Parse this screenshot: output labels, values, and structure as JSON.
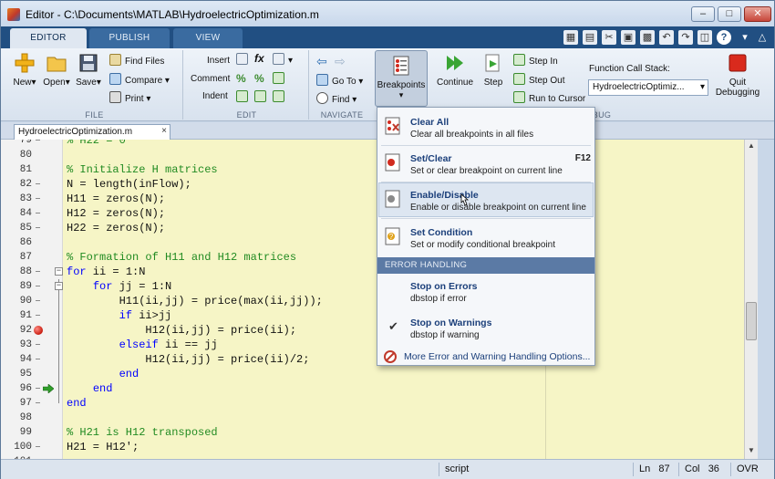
{
  "window": {
    "title": "Editor - C:\\Documents\\MATLAB\\HydroelectricOptimization.m"
  },
  "tabs": [
    "EDITOR",
    "PUBLISH",
    "VIEW"
  ],
  "toolstrip": {
    "file": {
      "label": "FILE",
      "new": "New",
      "open": "Open",
      "save": "Save",
      "find_files": "Find Files",
      "compare": "Compare",
      "print": "Print"
    },
    "edit": {
      "label": "EDIT",
      "insert": "Insert",
      "comment": "Comment",
      "indent": "Indent"
    },
    "navigate": {
      "label": "NAVIGATE",
      "goto": "Go To",
      "find": "Find"
    },
    "breakpoints": {
      "label": "Breakpoints"
    },
    "debug": {
      "label": "BUG",
      "continue": "Continue",
      "step": "Step",
      "step_in": "Step In",
      "step_out": "Step Out",
      "run_to_cursor": "Run to Cursor",
      "call_stack_label": "Function Call Stack:",
      "call_stack_value": "HydroelectricOptimiz...",
      "quit_line1": "Quit",
      "quit_line2": "Debugging"
    }
  },
  "file_tab": {
    "name": "HydroelectricOptimization.m",
    "close": "×"
  },
  "code": [
    {
      "n": "79",
      "text": "% H22 = 0",
      "type": "c",
      "marker": "dash"
    },
    {
      "n": "80",
      "text": "",
      "type": "p",
      "marker": ""
    },
    {
      "n": "81",
      "text": "% Initialize H matrices",
      "type": "c",
      "marker": ""
    },
    {
      "n": "82",
      "text": "N = length(inFlow);",
      "type": "p",
      "marker": "dash"
    },
    {
      "n": "83",
      "text": "H11 = zeros(N);",
      "type": "p",
      "marker": "dash"
    },
    {
      "n": "84",
      "text": "H12 = zeros(N);",
      "type": "p",
      "marker": "dash"
    },
    {
      "n": "85",
      "text": "H22 = zeros(N);",
      "type": "p",
      "marker": "dash"
    },
    {
      "n": "86",
      "text": "",
      "type": "p",
      "marker": ""
    },
    {
      "n": "87",
      "text": "% Formation of H11 and H12 matrices",
      "type": "c",
      "marker": ""
    },
    {
      "n": "88",
      "text": "for ii = 1:N",
      "type": "for1",
      "marker": "dash"
    },
    {
      "n": "89",
      "text": "    for jj = 1:N",
      "type": "for2",
      "marker": "dash"
    },
    {
      "n": "90",
      "text": "        H11(ii,jj) = price(max(ii,jj));",
      "type": "p",
      "marker": "dash"
    },
    {
      "n": "91",
      "text": "        if ii>jj",
      "type": "if",
      "marker": "dash"
    },
    {
      "n": "92",
      "text": "            H12(ii,jj) = price(ii);",
      "type": "p",
      "marker": "bp"
    },
    {
      "n": "93",
      "text": "        elseif ii == jj",
      "type": "elseif",
      "marker": "dash"
    },
    {
      "n": "94",
      "text": "            H12(ii,jj) = price(ii)/2;",
      "type": "p",
      "marker": "dash"
    },
    {
      "n": "95",
      "text": "        end",
      "type": "end",
      "marker": ""
    },
    {
      "n": "96",
      "text": "    end",
      "type": "end",
      "marker": "arrow"
    },
    {
      "n": "97",
      "text": "end",
      "type": "end",
      "marker": "dash"
    },
    {
      "n": "98",
      "text": "",
      "type": "p",
      "marker": ""
    },
    {
      "n": "99",
      "text": "% H21 is H12 transposed",
      "type": "c",
      "marker": ""
    },
    {
      "n": "100",
      "text": "H21 = H12';",
      "type": "p",
      "marker": "dash"
    },
    {
      "n": "101",
      "text": "",
      "type": "p",
      "marker": "dash"
    }
  ],
  "breakpoints_menu": {
    "clear_all": {
      "title": "Clear All",
      "subtitle": "Clear all breakpoints in all files"
    },
    "set_clear": {
      "title": "Set/Clear",
      "subtitle": "Set or clear breakpoint on current line",
      "shortcut": "F12"
    },
    "enable_disable": {
      "title": "Enable/Disable",
      "subtitle": "Enable or disable breakpoint on current line"
    },
    "set_condition": {
      "title": "Set Condition",
      "subtitle": "Set or modify conditional breakpoint"
    },
    "section_header": "ERROR HANDLING",
    "stop_on_errors": {
      "title": "Stop on Errors",
      "subtitle": "dbstop if error"
    },
    "stop_on_warnings": {
      "title": "Stop on Warnings",
      "subtitle": "dbstop if warning",
      "checked": true
    },
    "more_options": "More Error and Warning Handling Options..."
  },
  "status": {
    "mode": "script",
    "ln_label": "Ln",
    "ln_value": "87",
    "col_label": "Col",
    "col_value": "36",
    "ovr": "OVR"
  },
  "colors": {
    "ribbon_tabstrip": "#214f82",
    "comment_green": "#228b22",
    "keyword_blue": "#0000ff",
    "editor_bg": "#f6f5c6",
    "menu_title": "#1b3f7a"
  }
}
